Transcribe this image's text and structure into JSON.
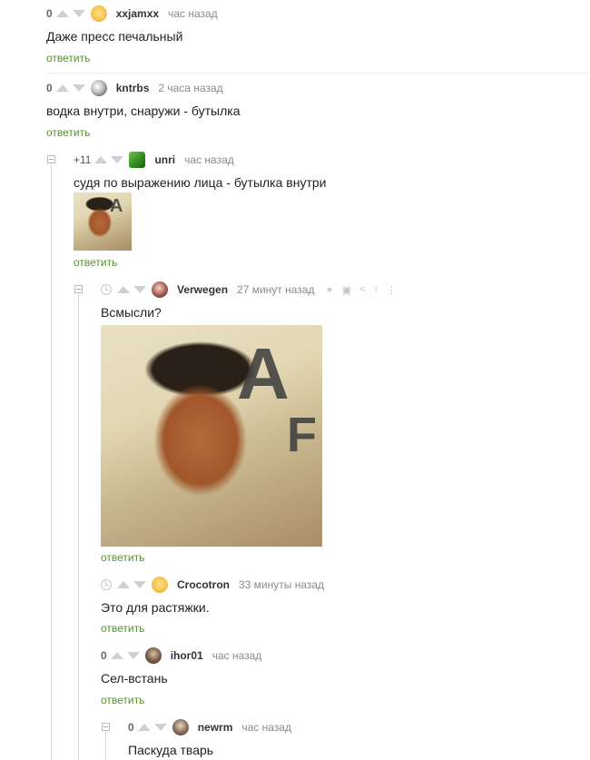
{
  "comments": [
    {
      "rating": "0",
      "author": "xxjamxx",
      "time": "час назад",
      "text": "Даже пресс печальный",
      "reply": "ответить"
    },
    {
      "rating": "0",
      "author": "kntrbs",
      "time": "2 часа назад",
      "text": "водка внутри, снаружи - бутылка",
      "reply": "ответить"
    },
    {
      "rating": "+11",
      "author": "unri",
      "time": "час назад",
      "text": "судя по выражению лица - бутылка внутри",
      "reply": "ответить"
    },
    {
      "rating": "",
      "author": "Verwegen",
      "time": "27 минут назад",
      "text": "Всмысли?",
      "reply": "ответить"
    },
    {
      "rating": "",
      "author": "Crocotron",
      "time": "33 минуты назад",
      "text": "Это для растяжки.",
      "reply": "ответить"
    },
    {
      "rating": "0",
      "author": "ihor01",
      "time": "час назад",
      "text": "Сел-встань",
      "reply": "ответить"
    },
    {
      "rating": "0",
      "author": "newrm",
      "time": "час назад",
      "text": "Паскуда тварь",
      "reply": ""
    }
  ],
  "icons": {
    "upvote": "triangle-up-icon",
    "downvote": "triangle-down-icon",
    "clock": "clock-icon",
    "link": "link-icon",
    "save": "save-icon",
    "share": "share-icon",
    "top": "arrow-up-icon"
  },
  "colors": {
    "reply_link": "#5a8d3a",
    "meta_text": "#8a8a8a",
    "vote_icon": "#d0d0d0"
  }
}
